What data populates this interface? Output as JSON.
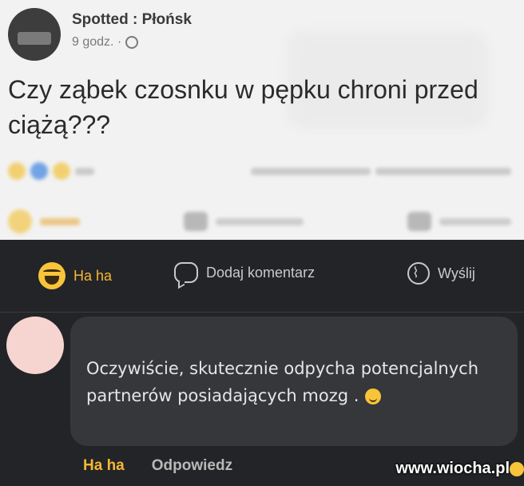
{
  "post": {
    "page_name": "Spotted : Płońsk",
    "time": "9 godz. ·",
    "text": "Czy ząbek czosnku w pępku chroni przed ciążą???"
  },
  "actions": {
    "haha_label": "Ha ha",
    "comment_label": "Dodaj komentarz",
    "send_label": "Wyślij"
  },
  "comment": {
    "text": "Oczywiście,  skutecznie odpycha potencjalnych partnerów posiadających mozg ."
  },
  "reply_actions": {
    "haha_label": "Ha ha",
    "reply_label": "Odpowiedz"
  },
  "watermark": "www.wiocha.pl",
  "colors": {
    "dark_bg": "#232427",
    "bubble_bg": "#36373a",
    "haha_accent": "#f4b735",
    "light_bg": "#f2f2f2"
  }
}
